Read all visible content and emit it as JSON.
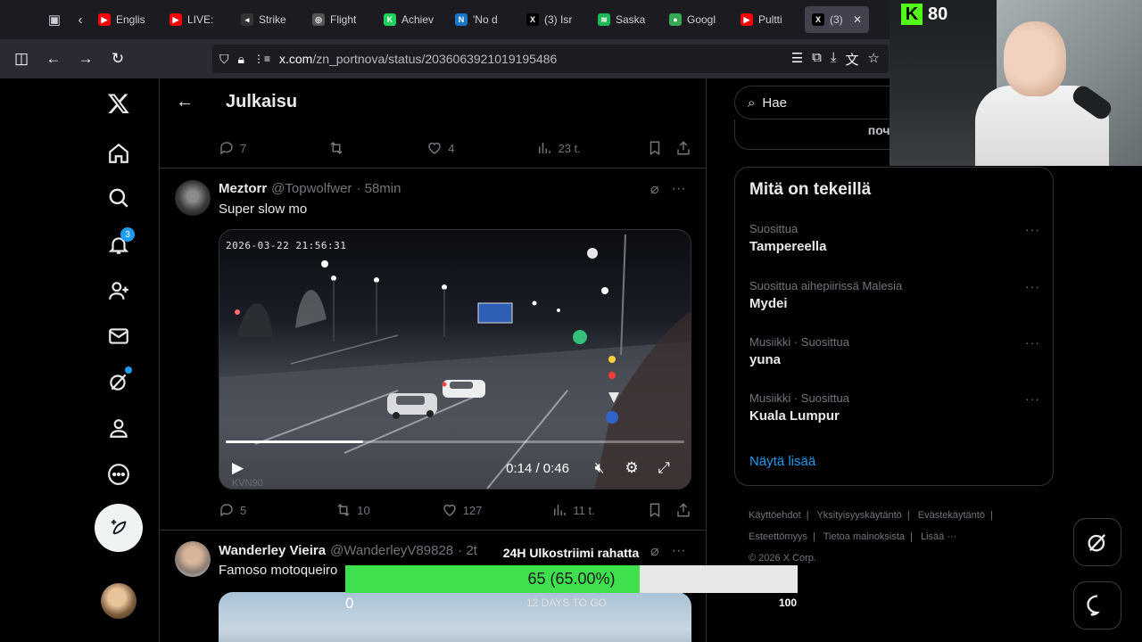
{
  "browser": {
    "tabs": [
      {
        "label": "Englis",
        "color": "#ff0000",
        "glyph": "▶"
      },
      {
        "label": "LIVE:",
        "color": "#ff0000",
        "glyph": "▶"
      },
      {
        "label": "Strike",
        "color": "#333333",
        "glyph": "◂"
      },
      {
        "label": "Flight",
        "color": "#555555",
        "glyph": "◎"
      },
      {
        "label": "Achiev",
        "color": "#1fd15a",
        "glyph": "K"
      },
      {
        "label": "'No d",
        "color": "#1877c9",
        "glyph": "N"
      },
      {
        "label": "(3) Isr",
        "color": "#000000",
        "glyph": "X"
      },
      {
        "label": "Saska",
        "color": "#1db954",
        "glyph": "≋"
      },
      {
        "label": "Googl",
        "color": "#34a853",
        "glyph": "●"
      },
      {
        "label": "Pultti",
        "color": "#ff0000",
        "glyph": "▶"
      },
      {
        "label": "(3)",
        "color": "#000000",
        "glyph": "X",
        "active": true
      }
    ],
    "url_host": "x.com",
    "url_path": "/zn_portnova/status/2036063921019195486"
  },
  "nav": {
    "notifications_badge": "3"
  },
  "main": {
    "header_title": "Julkaisu",
    "prev_tweet_actions": {
      "replies": "7",
      "reposts": "",
      "likes": "4",
      "views": "23 t."
    },
    "tweet1": {
      "name": "Meztorr",
      "handle": "@Topwolfwer",
      "time": "· 58min",
      "text": "Super slow mo",
      "video": {
        "timestamp": "2026-03-22 21:56:31",
        "watermark": "KVN90",
        "time": "0:14 / 0:46",
        "progress": 0.3
      },
      "actions": {
        "replies": "5",
        "reposts": "10",
        "likes": "127",
        "views": "11 t."
      }
    },
    "tweet2": {
      "name": "Wanderley Vieira",
      "handle": "@WanderleyV89828",
      "time": "· 2t",
      "text": "Famoso motoqueiro"
    }
  },
  "sidebar": {
    "search_placeholder": "Hae",
    "cut_text": "почуття.",
    "trends_title": "Mitä on tekeillä",
    "trends": [
      {
        "context": "Suosittua",
        "topic": "Tampereella"
      },
      {
        "context": "Suosittua aihepiirissä Malesia",
        "topic": "Mydei"
      },
      {
        "context": "Musiikki · Suosittua",
        "topic": "yuna"
      },
      {
        "context": "Musiikki · Suosittua",
        "topic": "Kuala Lumpur"
      }
    ],
    "show_more": "Näytä lisää",
    "footer": {
      "terms": "Käyttöehdot",
      "privacy": "Yksityisyyskäytäntö",
      "cookies": "Evästekäytäntö",
      "accessibility": "Esteettömyys",
      "ads": "Tietoa mainoksista",
      "more": "Lisää ···",
      "copyright": "© 2026 X Corp."
    }
  },
  "overlay": {
    "kick_count": "80",
    "goal_title": "24H Ulkostriimi rahatta",
    "goal_value": "65 (65.00%)",
    "goal_fraction": 0.65,
    "goal_min": "0",
    "goal_max": "100",
    "goal_sub": "12 DAYS TO GO"
  },
  "colors": {
    "accent": "#1d9bf0",
    "goal_fill": "#3ee04e",
    "kick": "#53fc18"
  }
}
